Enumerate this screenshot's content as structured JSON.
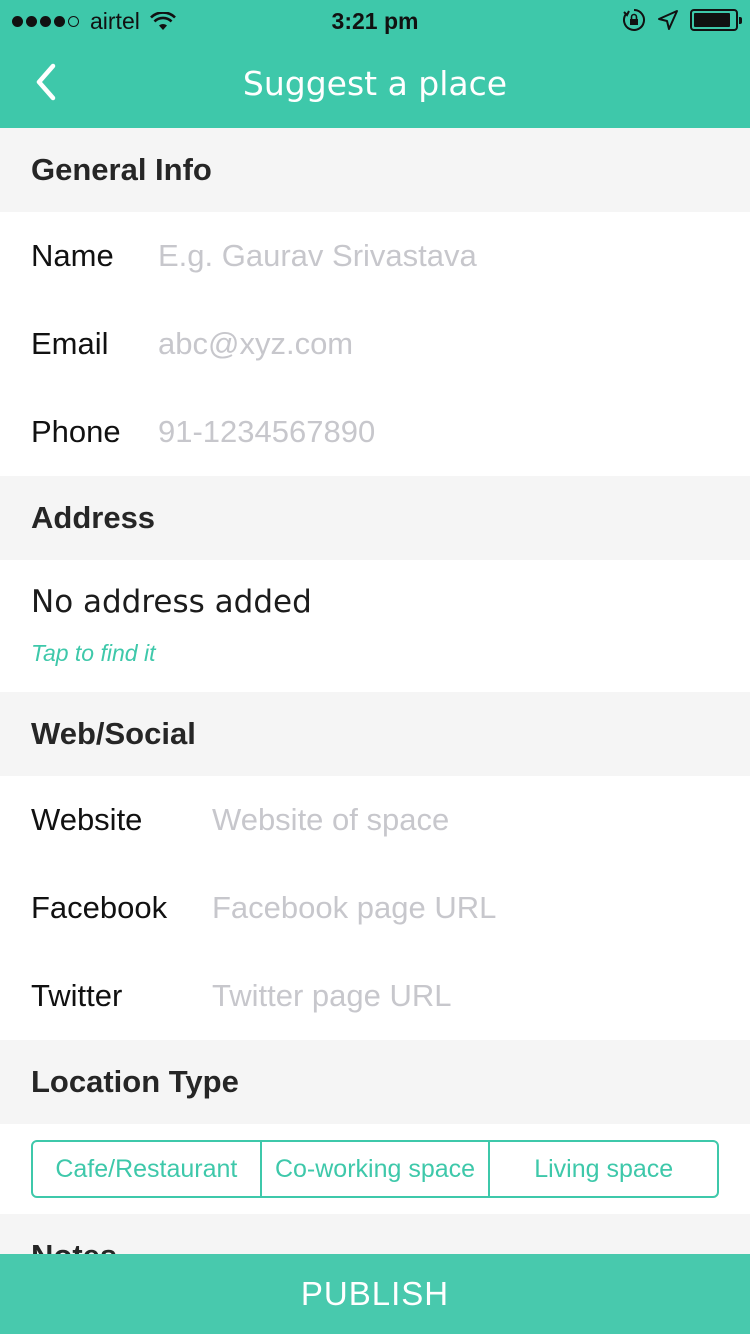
{
  "status_bar": {
    "carrier": "airtel",
    "time": "3:21 pm",
    "signal_dots_filled": 4,
    "signal_dots_total": 5
  },
  "nav": {
    "title": "Suggest a place",
    "back_icon": "chevron-left-icon"
  },
  "general_info": {
    "header": "General Info",
    "fields": [
      {
        "label": "Name",
        "placeholder": "E.g. Gaurav Srivastava",
        "value": ""
      },
      {
        "label": "Email",
        "placeholder": "abc@xyz.com",
        "value": ""
      },
      {
        "label": "Phone",
        "placeholder": "91-1234567890",
        "value": ""
      }
    ]
  },
  "address": {
    "header": "Address",
    "status": "No address added",
    "action": "Tap to find it"
  },
  "web_social": {
    "header": "Web/Social",
    "fields": [
      {
        "label": "Website",
        "placeholder": "Website of space",
        "value": ""
      },
      {
        "label": "Facebook",
        "placeholder": "Facebook page URL",
        "value": ""
      },
      {
        "label": "Twitter",
        "placeholder": "Twitter page URL",
        "value": ""
      }
    ]
  },
  "location_type": {
    "header": "Location Type",
    "options": [
      "Cafe/Restaurant",
      "Co-working space",
      "Living space"
    ]
  },
  "notes": {
    "header": "Notes"
  },
  "publish_label": "PUBLISH",
  "colors": {
    "accent": "#3ec8aa",
    "section_bg": "#f5f5f5",
    "placeholder": "#c7c7cc"
  }
}
